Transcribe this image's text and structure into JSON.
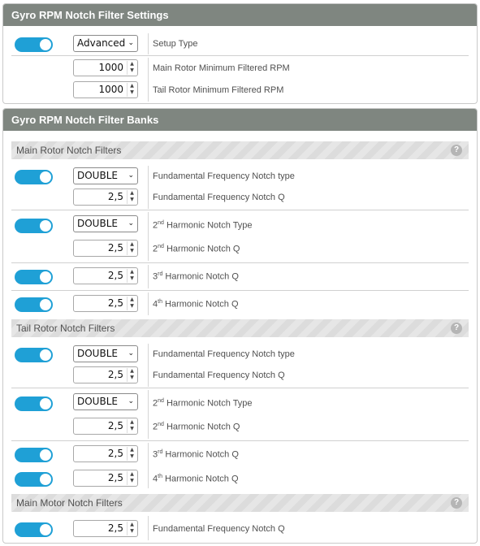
{
  "settings": {
    "title": "Gyro RPM Notch Filter Settings",
    "setup_type_value": "Advanced",
    "setup_type_label": "Setup Type",
    "main_rotor_min_value": "1000",
    "main_rotor_min_label": "Main Rotor Minimum Filtered RPM",
    "tail_rotor_min_value": "1000",
    "tail_rotor_min_label": "Tail Rotor Minimum Filtered RPM"
  },
  "banks": {
    "title": "Gyro RPM Notch Filter Banks",
    "help_glyph": "?",
    "main_rotor": {
      "title": "Main Rotor Notch Filters",
      "fund_type_value": "DOUBLE",
      "fund_type_label": "Fundamental Frequency Notch type",
      "fund_q_value": "2,5",
      "fund_q_label": "Fundamental Frequency Notch Q",
      "h2_type_value": "DOUBLE",
      "h2_type_label_num": "2",
      "h2_type_label_sup": "nd",
      "h2_type_label_text": " Harmonic Notch Type",
      "h2_q_value": "2,5",
      "h2_q_label_num": "2",
      "h2_q_label_sup": "nd",
      "h2_q_label_text": " Harmonic Notch Q",
      "h3_q_value": "2,5",
      "h3_q_label_num": "3",
      "h3_q_label_sup": "rd",
      "h3_q_label_text": " Harmonic Notch Q",
      "h4_q_value": "2,5",
      "h4_q_label_num": "4",
      "h4_q_label_sup": "th",
      "h4_q_label_text": " Harmonic Notch Q"
    },
    "tail_rotor": {
      "title": "Tail Rotor Notch Filters",
      "fund_type_value": "DOUBLE",
      "fund_type_label": "Fundamental Frequency Notch type",
      "fund_q_value": "2,5",
      "fund_q_label": "Fundamental Frequency Notch Q",
      "h2_type_value": "DOUBLE",
      "h2_type_label_num": "2",
      "h2_type_label_sup": "nd",
      "h2_type_label_text": " Harmonic Notch Type",
      "h2_q_value": "2,5",
      "h2_q_label_num": "2",
      "h2_q_label_sup": "nd",
      "h2_q_label_text": " Harmonic Notch Q",
      "h3_q_value": "2,5",
      "h3_q_label_num": "3",
      "h3_q_label_sup": "rd",
      "h3_q_label_text": " Harmonic Notch Q",
      "h4_q_value": "2,5",
      "h4_q_label_num": "4",
      "h4_q_label_sup": "th",
      "h4_q_label_text": " Harmonic Notch Q"
    },
    "main_motor": {
      "title": "Main Motor Notch Filters",
      "fund_q_value": "2,5",
      "fund_q_label": "Fundamental Frequency Notch Q"
    }
  },
  "spin_up_glyph": "▲",
  "spin_down_glyph": "▼",
  "chevron_glyph": "⌄",
  "colors": {
    "header_bg": "#7f8680",
    "toggle_on": "#1fa0d6"
  },
  "icons": [
    "toggle-switch",
    "chevron-down-icon",
    "spinner-arrows-icon",
    "help-icon"
  ]
}
